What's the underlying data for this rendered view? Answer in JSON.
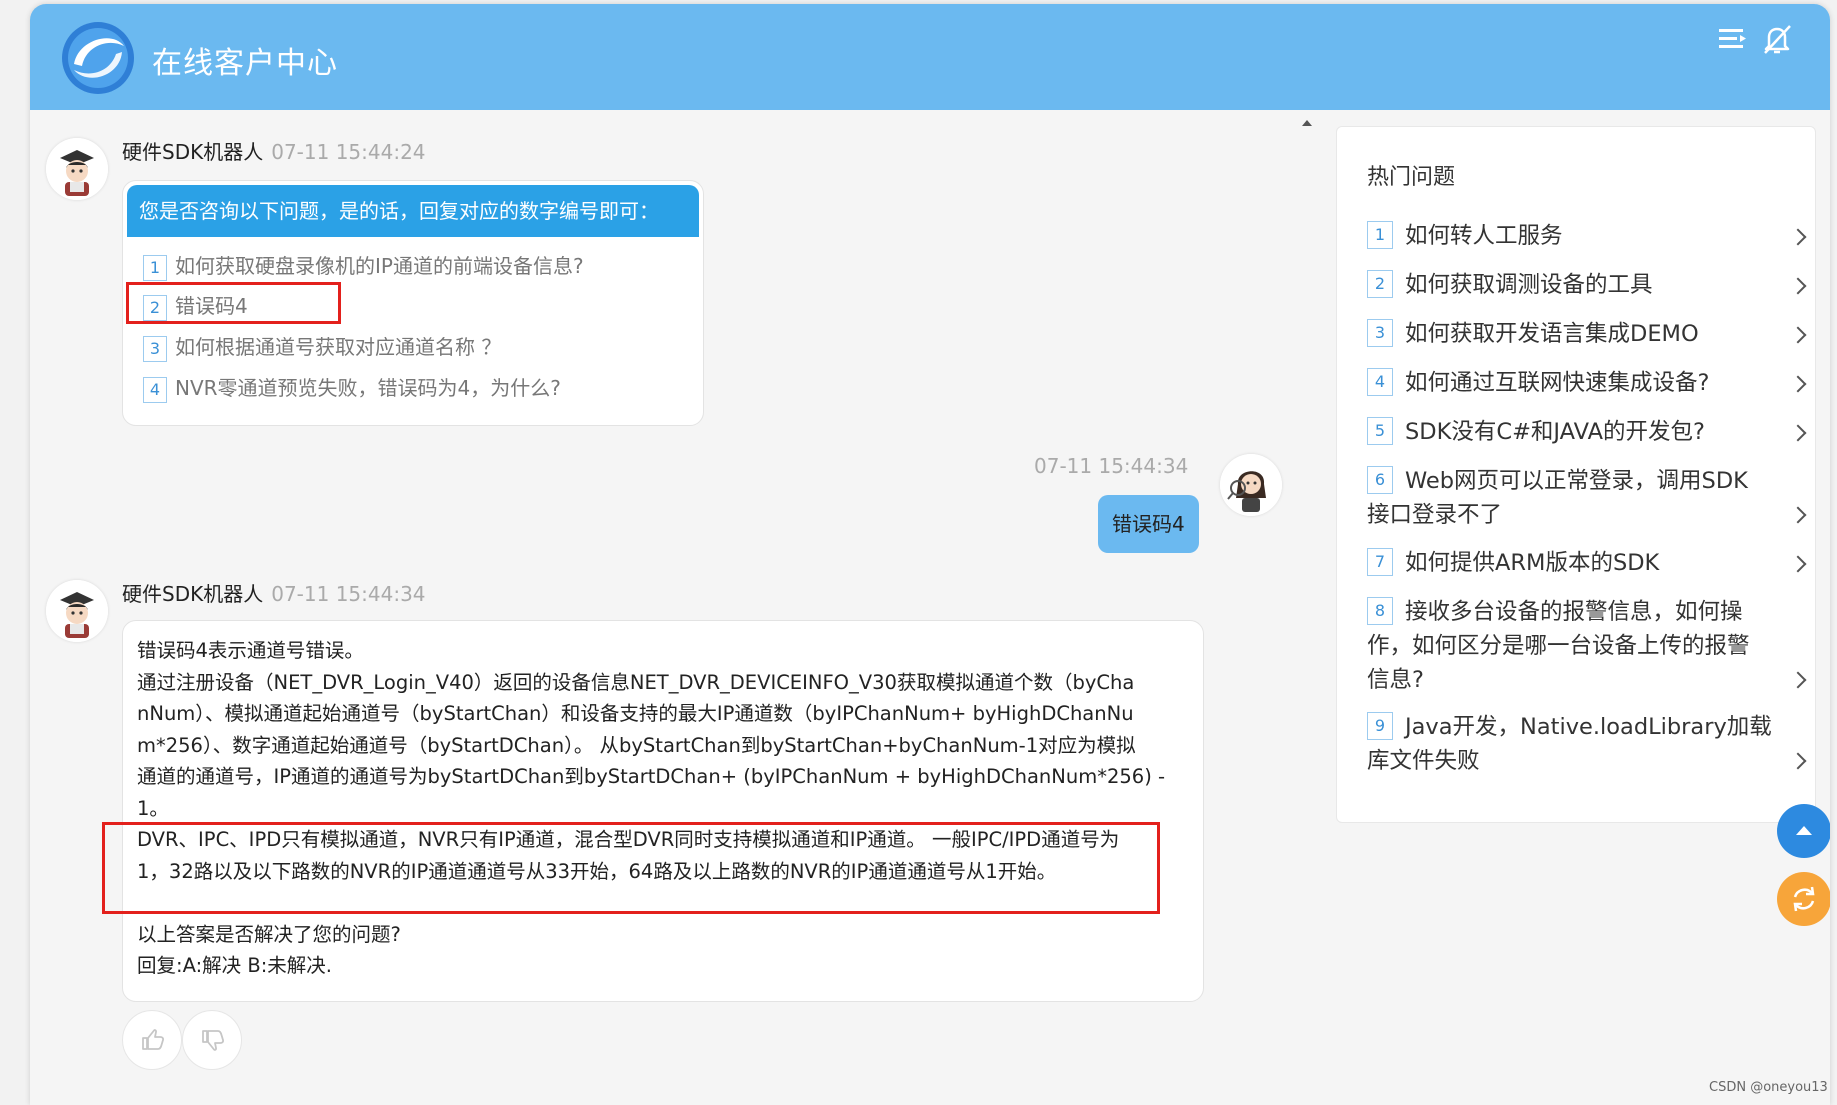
{
  "header": {
    "title": "在线客户中心",
    "menu_icon": "menu-icon",
    "bell_icon": "bell-off-icon",
    "colors": {
      "header_bg": "#6bb9f0",
      "accent": "#2ba1e6",
      "highlight": "#e3201c"
    }
  },
  "chat": {
    "bot_message_1": {
      "sender": "硬件SDK机器人",
      "time": "07-11 15:44:24",
      "header": "您是否咨询以下问题，是的话，回复对应的数字编号即可：",
      "options": [
        {
          "num": "1",
          "text": "如何获取硬盘录像机的IP通道的前端设备信息?"
        },
        {
          "num": "2",
          "text": "错误码4"
        },
        {
          "num": "3",
          "text": "如何根据通道号获取对应通道名称 ？"
        },
        {
          "num": "4",
          "text": "NVR零通道预览失败，错误码为4，为什么?"
        }
      ]
    },
    "user_message": {
      "time": "07-11 15:44:34",
      "text": "错误码4"
    },
    "bot_message_2": {
      "sender": "硬件SDK机器人",
      "time": "07-11 15:44:34",
      "lines": [
        "错误码4表示通道号错误。",
        "通过注册设备（NET_DVR_Login_V40）返回的设备信息NET_DVR_DEVICEINFO_V30获取模拟通道个数（byCha",
        "nNum）、模拟通道起始通道号（byStartChan）和设备支持的最大IP通道数（byIPChanNum+ byHighDChanNu",
        "m*256）、数字通道起始通道号（byStartDChan）。 从byStartChan到byStartChan+byChanNum-1对应为模拟",
        "通道的通道号，IP通道的通道号为byStartDChan到byStartDChan+ (byIPChanNum + byHighDChanNum*256) -",
        "1。",
        "DVR、IPC、IPD只有模拟通道，NVR只有IP通道，混合型DVR同时支持模拟通道和IP通道。 一般IPC/IPD通道号为",
        "1，32路以及以下路数的NVR的IP通道通道号从33开始，64路及以上路数的NVR的IP通道通道号从1开始。",
        "",
        "以上答案是否解决了您的问题?",
        "回复:A:解决 B:未解决."
      ]
    }
  },
  "sidebar": {
    "title": "热门问题",
    "items": [
      {
        "num": "1",
        "lines": [
          "如何转人工服务"
        ]
      },
      {
        "num": "2",
        "lines": [
          "如何获取调测设备的工具"
        ]
      },
      {
        "num": "3",
        "lines": [
          "如何获取开发语言集成DEMO"
        ]
      },
      {
        "num": "4",
        "lines": [
          "如何通过互联网快速集成设备?"
        ]
      },
      {
        "num": "5",
        "lines": [
          "SDK没有C#和JAVA的开发包?"
        ]
      },
      {
        "num": "6",
        "lines": [
          "Web网页可以正常登录，调用SDK",
          "接口登录不了"
        ]
      },
      {
        "num": "7",
        "lines": [
          "如何提供ARM版本的SDK"
        ]
      },
      {
        "num": "8",
        "lines": [
          "接收多台设备的报警信息，如何操",
          "作，如何区分是哪一台设备上传的报警",
          "信息?"
        ]
      },
      {
        "num": "9",
        "lines": [
          "Java开发，Native.loadLibrary加载",
          "库文件失败"
        ]
      }
    ]
  },
  "watermark": "CSDN @oneyou13"
}
